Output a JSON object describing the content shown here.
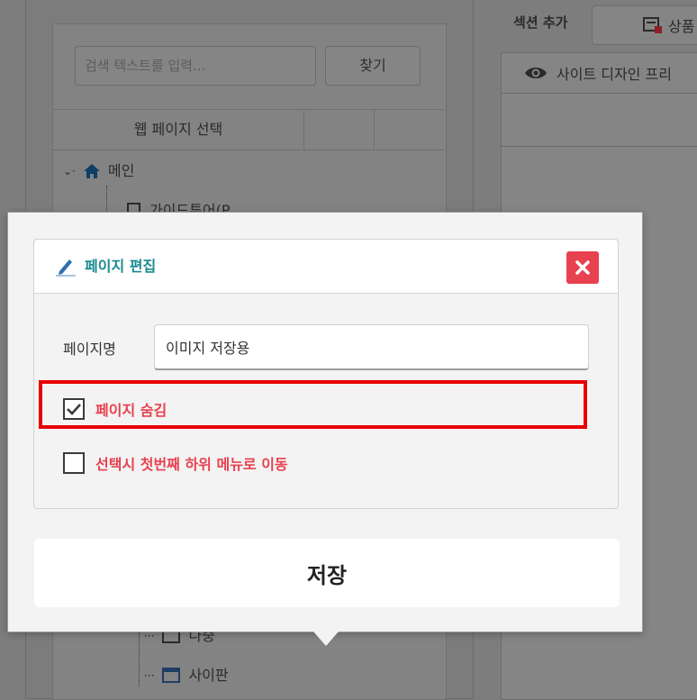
{
  "background": {
    "search_placeholder": "검색 텍스트를 입력...",
    "find_button": "찾기",
    "grid_header": "웹 페이지 선택",
    "tree": {
      "root": "메인",
      "item_guide": "가이드투어(P",
      "item_lower_1": "나중",
      "item_lower_2": "사이판"
    },
    "section_add_label": "섹션 추가",
    "product_button": "상품",
    "site_preview_button": "사이트 디자인 프리"
  },
  "modal": {
    "title": "페이지 편집",
    "page_name_label": "페이지명",
    "page_name_value": "이미지 저장용",
    "hide_page_label": "페이지 숨김",
    "hide_page_checked": true,
    "move_first_sub_label": "선택시 첫번째 하위 메뉴로 이동",
    "move_first_sub_checked": false,
    "save_button": "저장"
  },
  "colors": {
    "accent_title": "#1a8a8f",
    "danger": "#e8414f",
    "highlight": "#e80000"
  },
  "icons": {
    "edit": "pencil-edit-icon",
    "close": "close-icon",
    "check": "checkmark-icon",
    "home": "home-icon",
    "eye": "eye-icon",
    "product": "product-icon"
  }
}
